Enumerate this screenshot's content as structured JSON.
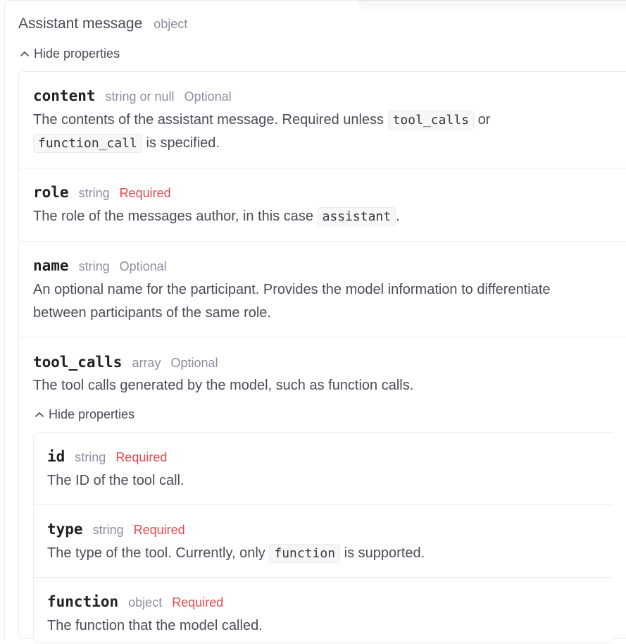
{
  "section": {
    "title": "Assistant message",
    "type": "object",
    "toggle_label": "Hide properties"
  },
  "props": {
    "content": {
      "name": "content",
      "type": "string or null",
      "status": "Optional",
      "desc_1": "The contents of the assistant message. Required unless",
      "code_1": "tool_calls",
      "desc_2": "or",
      "code_2": "function_call",
      "desc_3": "is specified."
    },
    "role": {
      "name": "role",
      "type": "string",
      "status": "Required",
      "desc_1": "The role of the messages author, in this case",
      "code_1": "assistant",
      "desc_2": "."
    },
    "name": {
      "name": "name",
      "type": "string",
      "status": "Optional",
      "desc_1": "An optional name for the participant. Provides the model information to differentiate",
      "desc_2": "between participants of the same role."
    },
    "tool_calls": {
      "name": "tool_calls",
      "type": "array",
      "status": "Optional",
      "desc": "The tool calls generated by the model, such as function calls.",
      "toggle_label": "Hide properties",
      "children": {
        "id": {
          "name": "id",
          "type": "string",
          "status": "Required",
          "desc": "The ID of the tool call."
        },
        "type": {
          "name": "type",
          "type": "string",
          "status": "Required",
          "desc_1": "The type of the tool. Currently, only",
          "code_1": "function",
          "desc_2": "is supported."
        },
        "function": {
          "name": "function",
          "type": "object",
          "status": "Required",
          "desc": "The function that the model called."
        }
      }
    }
  },
  "colors": {
    "required": "#e5484d",
    "muted": "#8e8ea0",
    "border": "#ececf1"
  }
}
